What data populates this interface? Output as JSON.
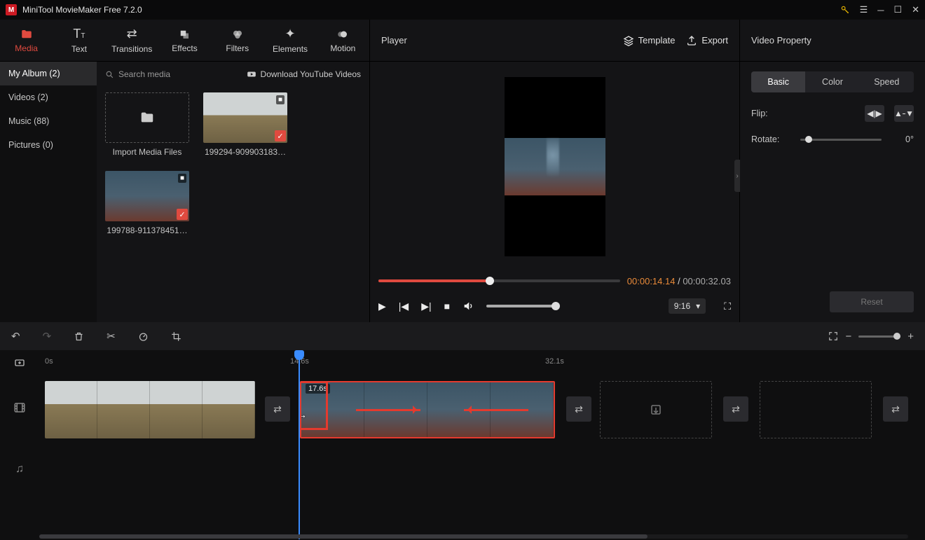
{
  "app": {
    "title": "MiniTool MovieMaker Free 7.2.0"
  },
  "toptabs": {
    "media": "Media",
    "text": "Text",
    "transitions": "Transitions",
    "effects": "Effects",
    "filters": "Filters",
    "elements": "Elements",
    "motion": "Motion"
  },
  "album": {
    "myalbum": "My Album (2)",
    "videos": "Videos (2)",
    "music": "Music (88)",
    "pictures": "Pictures (0)"
  },
  "mediabar": {
    "search_placeholder": "Search media",
    "download_yt": "Download YouTube Videos"
  },
  "mediaitems": {
    "import": "Import Media Files",
    "item1": "199294-909903183…",
    "item2": "199788-911378451…"
  },
  "player": {
    "title": "Player",
    "template": "Template",
    "export": "Export",
    "time_current": "00:00:14.14",
    "time_sep": " / ",
    "time_total": "00:00:32.03",
    "ratio": "9:16"
  },
  "props": {
    "title": "Video Property",
    "tab_basic": "Basic",
    "tab_color": "Color",
    "tab_speed": "Speed",
    "flip": "Flip:",
    "rotate": "Rotate:",
    "rotate_val": "0°",
    "reset": "Reset"
  },
  "timeline": {
    "t0": "0s",
    "t_play": "14.6s",
    "t_end": "32.1s",
    "clip2_label": "17.6s"
  }
}
